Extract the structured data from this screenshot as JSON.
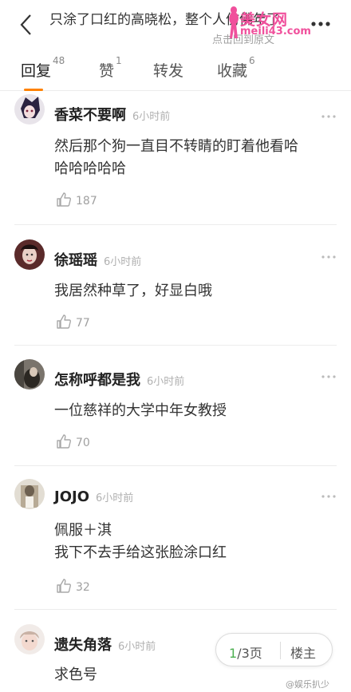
{
  "header": {
    "title": "只涂了口红的高晓松，整个人仿佛年了",
    "subtitle": "点击回到原文",
    "watermark_site": "美女网",
    "watermark_url": "meili43.com"
  },
  "tabs": [
    {
      "label": "回复",
      "count": "48"
    },
    {
      "label": "赞",
      "count": "1"
    },
    {
      "label": "转发",
      "count": ""
    },
    {
      "label": "收藏",
      "count": "6"
    }
  ],
  "comments": [
    {
      "user": "香菜不要啊",
      "time": "6小时前",
      "text_lines": [
        "然后那个狗一直目不转睛的盯着他看哈",
        "哈哈哈哈哈"
      ],
      "likes": "187"
    },
    {
      "user": "徐瑶瑶",
      "time": "6小时前",
      "text_lines": [
        "我居然种草了，好显白哦"
      ],
      "likes": "77"
    },
    {
      "user": "怎称呼都是我",
      "time": "6小时前",
      "text_lines": [
        "一位慈祥的大学中年女教授"
      ],
      "likes": "70"
    },
    {
      "user": "JOJO",
      "time": "6小时前",
      "text_lines": [
        "佩服＋淇",
        "我下不去手给这张脸涂口红"
      ],
      "likes": "32"
    },
    {
      "user": "遗失角落",
      "time": "6小时前",
      "text_lines": [
        "求色号"
      ],
      "likes": ""
    }
  ],
  "pager": {
    "current": "1",
    "total": "/3页",
    "floor_label": "楼主"
  },
  "corner_watermark": "@娱乐扒少",
  "colors": {
    "tab_underline": "#ff8200",
    "pager_current": "#4caf50",
    "watermark": "#f0509c"
  }
}
